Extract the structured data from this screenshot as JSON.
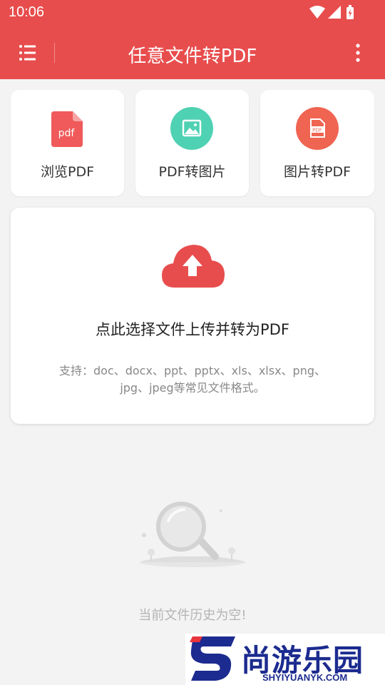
{
  "status_bar": {
    "time": "10:06"
  },
  "app_bar": {
    "title": "任意文件转PDF",
    "menu_icon": "list-menu-icon",
    "more_icon": "more-vertical-icon"
  },
  "tools": [
    {
      "label": "浏览PDF",
      "icon": "pdf-file-icon"
    },
    {
      "label": "PDF转图片",
      "icon": "image-icon"
    },
    {
      "label": "图片转PDF",
      "icon": "image-to-pdf-icon"
    }
  ],
  "upload": {
    "icon": "cloud-upload-icon",
    "title": "点此选择文件上传并转为PDF",
    "support_line1": "支持：doc、docx、ppt、pptx、xls、xlsx、png、",
    "support_line2": "jpg、jpeg等常见文件格式。"
  },
  "history": {
    "icon": "magnifier-empty-icon",
    "empty_text": "当前文件历史为空!"
  },
  "watermark": {
    "text": "尚游乐园",
    "url": "SHYIYUANYK.COM"
  },
  "colors": {
    "primary": "#e84d4d",
    "teal": "#4fd1b3",
    "coral": "#f06452"
  }
}
